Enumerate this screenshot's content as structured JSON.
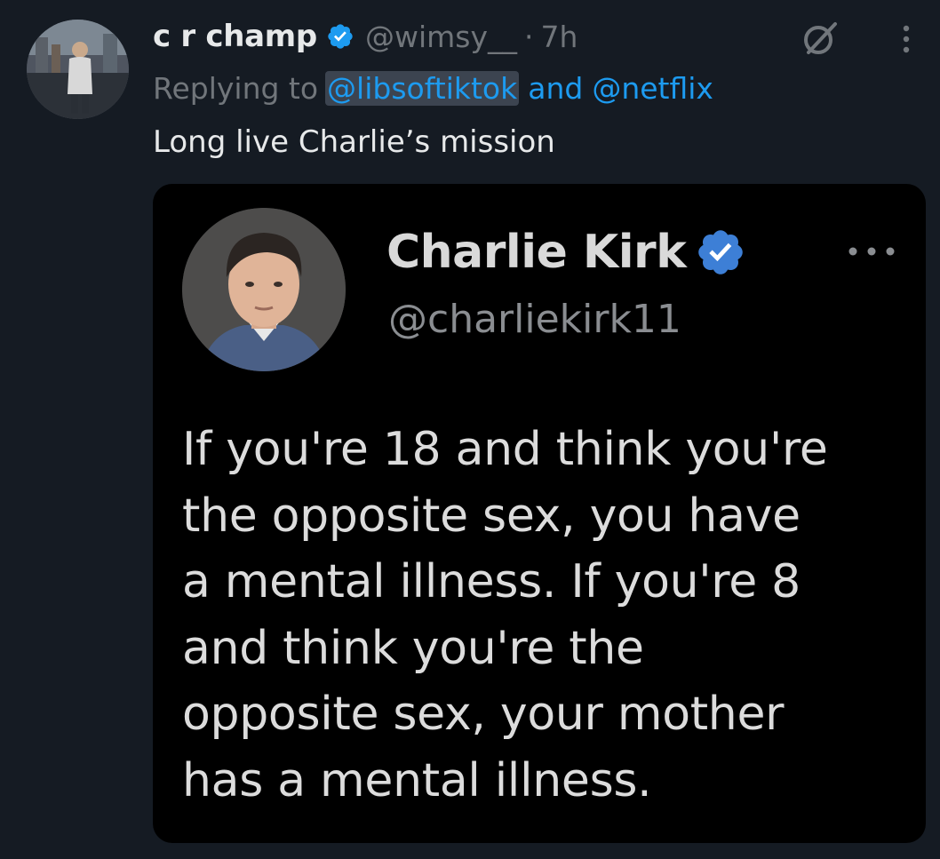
{
  "tweet": {
    "display_name": "c r champ",
    "handle": "@wimsy__",
    "separator": "·",
    "time": "7h",
    "replying_prefix": "Replying to",
    "reply_to_1": "@libsoftiktok",
    "reply_and": "and",
    "reply_to_2": "@netflix",
    "text": "Long live Charlie’s mission"
  },
  "embed": {
    "name": "Charlie Kirk",
    "handle": "@charliekirk11",
    "lines": [
      "If you're 18 and think you're",
      "the opposite sex, you have",
      "a mental illness. If you're 8",
      "and think you're the",
      "opposite sex, your mother",
      "has a mental illness."
    ]
  },
  "icons": {
    "verified": "verified-badge-icon",
    "grok": "grok-icon",
    "more": "more-vertical-icon",
    "embed_more": "more-horizontal-icon"
  },
  "colors": {
    "background": "#151b23",
    "accent": "#1d9bf0",
    "secondary_text": "#71767b",
    "primary_text": "#e7e9ea"
  }
}
